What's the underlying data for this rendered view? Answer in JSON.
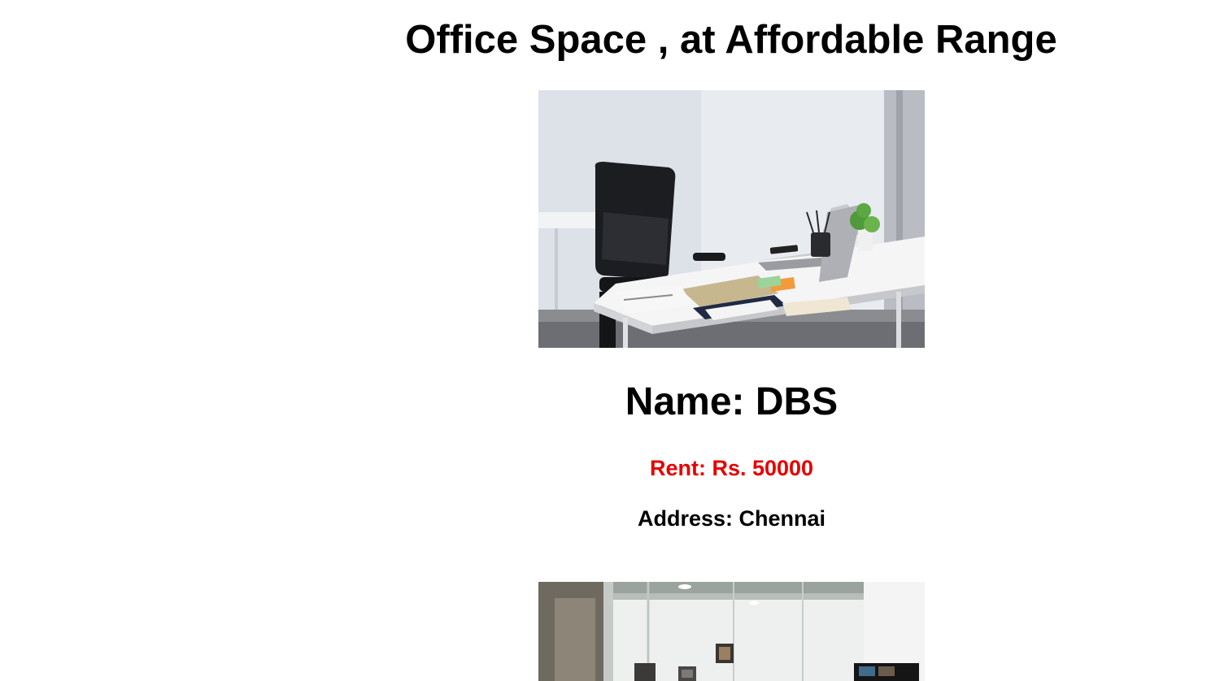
{
  "page": {
    "title": "Office Space , at Affordable Range"
  },
  "listings": [
    {
      "name": "Name: DBS",
      "rent": "Rent: Rs. 50000",
      "address": "Address: Chennai",
      "photo_icon": "office-desk-photo"
    },
    {
      "photo_icon": "office-interior-photo"
    }
  ],
  "colors": {
    "rent_text": "#e60000",
    "background": "#ffffff"
  }
}
